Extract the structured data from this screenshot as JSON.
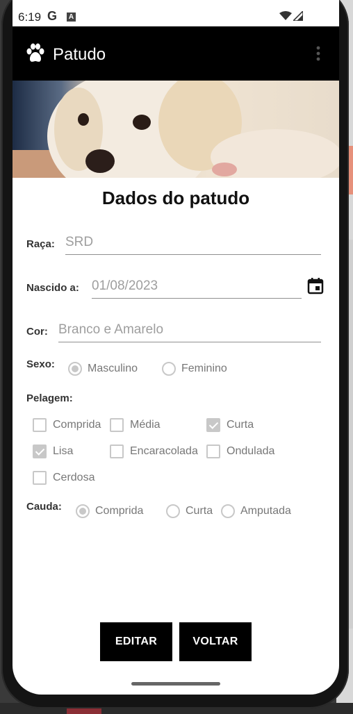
{
  "status": {
    "time": "6:19",
    "g": "G",
    "a": "A"
  },
  "appbar": {
    "title": "Patudo",
    "icon": "paw-icon",
    "menu_icon": "more-vert-icon"
  },
  "page_title": "Dados do patudo",
  "fields": {
    "raca": {
      "label": "Raça:",
      "value": "SRD"
    },
    "nascido": {
      "label": "Nascido a:",
      "value": "01/08/2023",
      "icon": "calendar-icon"
    },
    "cor": {
      "label": "Cor:",
      "value": "Branco e Amarelo"
    }
  },
  "sexo": {
    "label": "Sexo:",
    "options": [
      {
        "label": "Masculino",
        "selected": true
      },
      {
        "label": "Feminino",
        "selected": false
      }
    ]
  },
  "pelagem": {
    "label": "Pelagem:",
    "options": [
      {
        "label": "Comprida",
        "checked": false
      },
      {
        "label": "Média",
        "checked": false
      },
      {
        "label": "Curta",
        "checked": true
      },
      {
        "label": "Lisa",
        "checked": true
      },
      {
        "label": "Encaracolada",
        "checked": false
      },
      {
        "label": "Ondulada",
        "checked": false
      },
      {
        "label": "Cerdosa",
        "checked": false
      }
    ]
  },
  "cauda": {
    "label": "Cauda:",
    "options": [
      {
        "label": "Comprida",
        "selected": true
      },
      {
        "label": "Curta",
        "selected": false
      },
      {
        "label": "Amputada",
        "selected": false
      }
    ]
  },
  "buttons": {
    "editar": "EDITAR",
    "voltar": "VOLTAR"
  }
}
